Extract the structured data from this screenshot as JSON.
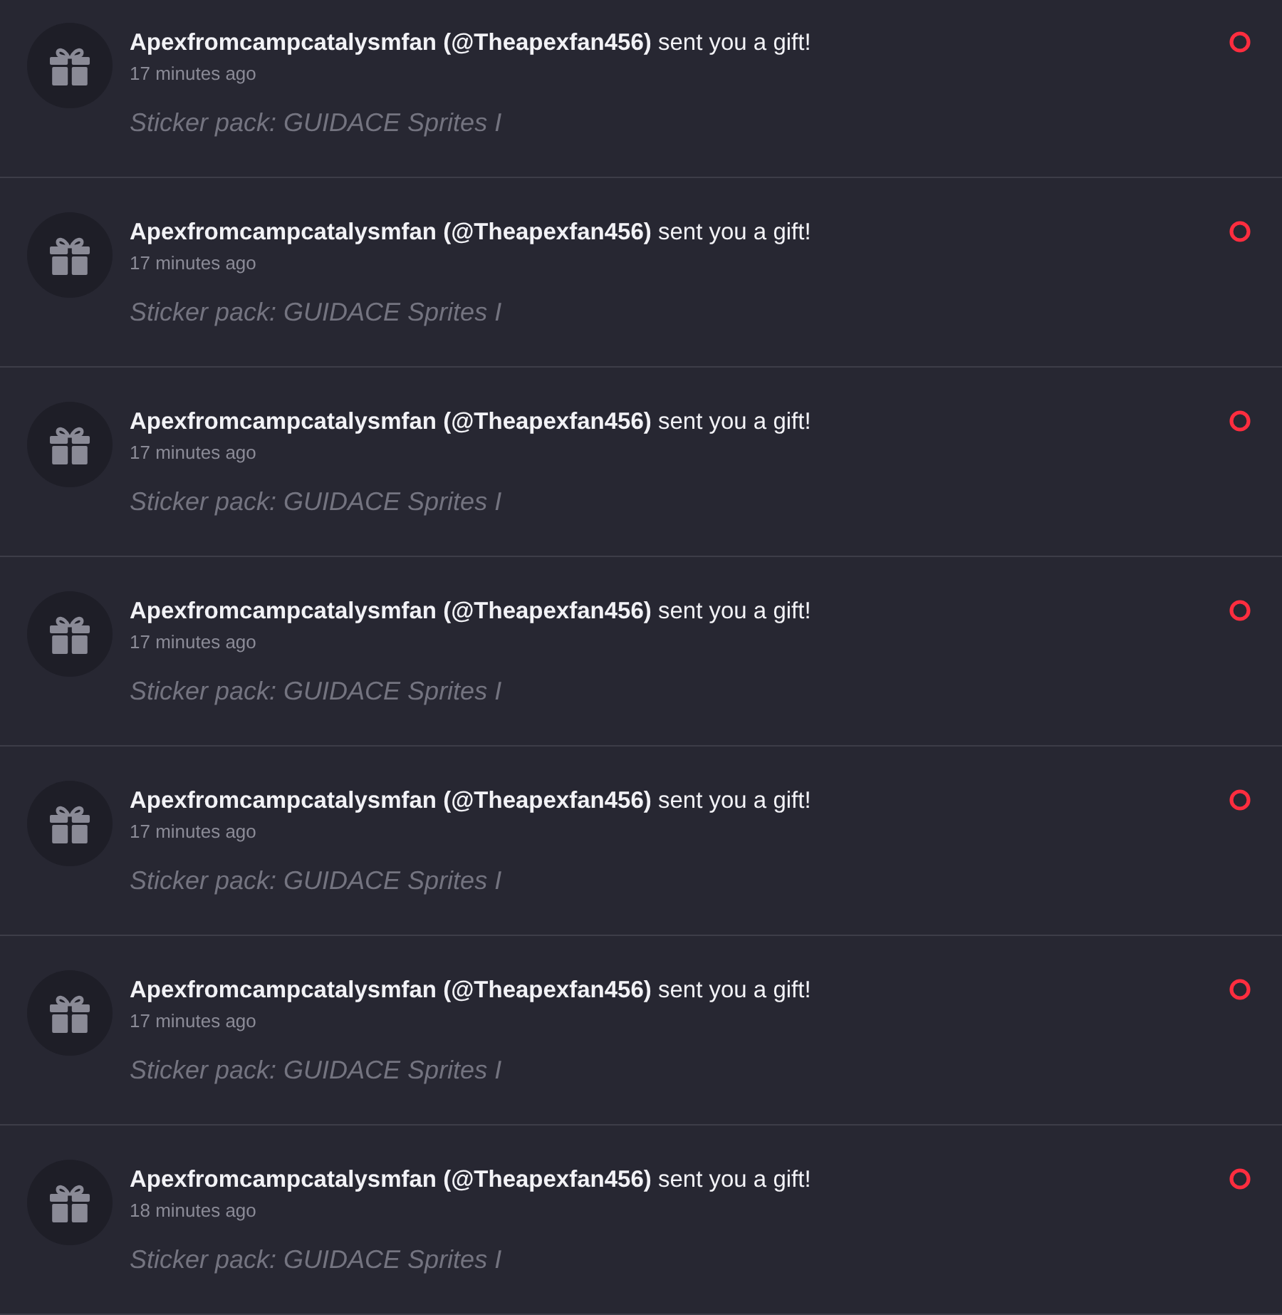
{
  "notifications": [
    {
      "title": "**Apexfromcampcatalysmfan (@Theapexfan456)** sent you a gift!",
      "time": "17 minutes ago",
      "detail": "Sticker pack: GUIDACE Sprites I",
      "unread": true
    },
    {
      "title": "**Apexfromcampcatalysmfan (@Theapexfan456)** sent you a gift!",
      "time": "17 minutes ago",
      "detail": "Sticker pack: GUIDACE Sprites I",
      "unread": true
    },
    {
      "title": "**Apexfromcampcatalysmfan (@Theapexfan456)** sent you a gift!",
      "time": "17 minutes ago",
      "detail": "Sticker pack: GUIDACE Sprites I",
      "unread": true
    },
    {
      "title": "**Apexfromcampcatalysmfan (@Theapexfan456)** sent you a gift!",
      "time": "17 minutes ago",
      "detail": "Sticker pack: GUIDACE Sprites I",
      "unread": true
    },
    {
      "title": "**Apexfromcampcatalysmfan (@Theapexfan456)** sent you a gift!",
      "time": "17 minutes ago",
      "detail": "Sticker pack: GUIDACE Sprites I",
      "unread": true
    },
    {
      "title": "**Apexfromcampcatalysmfan (@Theapexfan456)** sent you a gift!",
      "time": "17 minutes ago",
      "detail": "Sticker pack: GUIDACE Sprites I",
      "unread": true
    },
    {
      "title": "**Apexfromcampcatalysmfan (@Theapexfan456)** sent you a gift!",
      "time": "18 minutes ago",
      "detail": "Sticker pack: GUIDACE Sprites I",
      "unread": true
    }
  ]
}
